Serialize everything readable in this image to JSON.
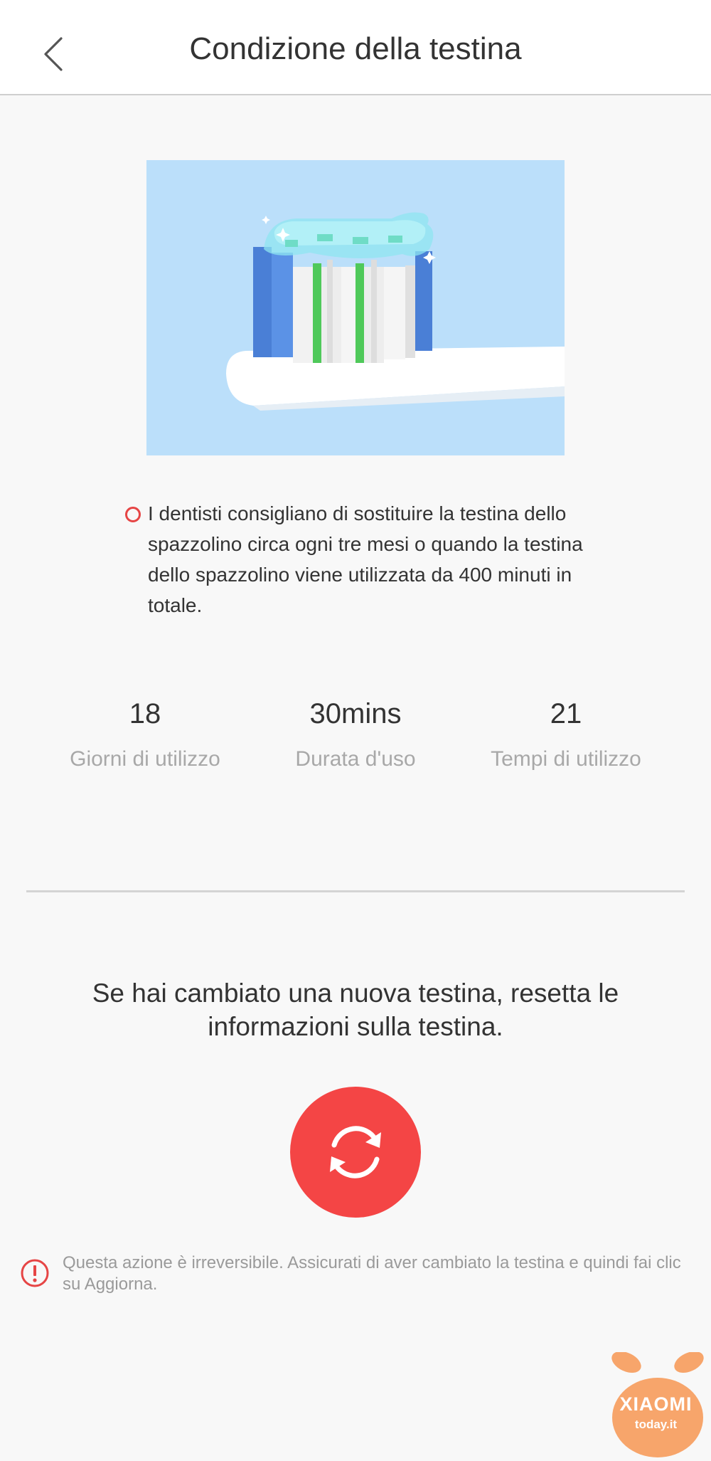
{
  "header": {
    "title": "Condizione della testina"
  },
  "tip": {
    "text": "I dentisti consigliano di sostituire la testina dello spazzolino circa ogni tre mesi o quando la testina dello spazzolino viene utilizzata da 400 minuti in totale."
  },
  "stats": [
    {
      "value": "18",
      "label": "Giorni di utilizzo"
    },
    {
      "value": "30mins",
      "label": "Durata d'uso"
    },
    {
      "value": "21",
      "label": "Tempi di utilizzo"
    }
  ],
  "reset": {
    "message": "Se hai cambiato una nuova testina, resetta le informazioni sulla testina."
  },
  "warning": {
    "text": "Questa azione è irreversibile. Assicurati di aver cambiato la testina e quindi fai clic su Aggiorna."
  },
  "watermark": {
    "brand": "XIAOMI",
    "site": "today.it"
  },
  "colors": {
    "accent": "#f44545",
    "illustration_bg": "#bbdffa"
  }
}
